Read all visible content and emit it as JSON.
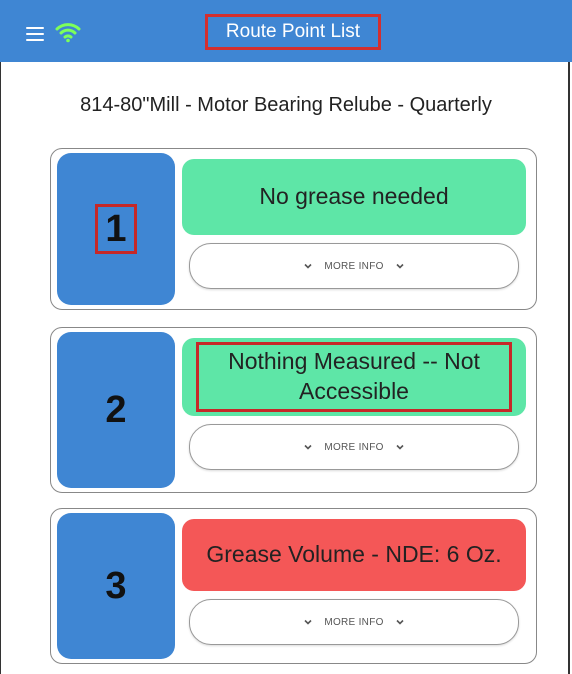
{
  "topbar": {
    "menu_icon": "hamburger-menu-icon",
    "wifi_icon": "wifi-icon",
    "title": "Route Point List"
  },
  "route": {
    "name": "814-80\"Mill - Motor Bearing Relube - Quarterly"
  },
  "points": [
    {
      "number": "1",
      "status": "No grease needed",
      "status_color": "#5ee6a7",
      "more_label": "MORE INFO"
    },
    {
      "number": "2",
      "status": "Nothing Measured -- Not Accessible",
      "status_color": "#5ee6a7",
      "more_label": "MORE INFO"
    },
    {
      "number": "3",
      "status": "Grease Volume - NDE: 6 Oz.",
      "status_color": "#f45757",
      "more_label": "MORE INFO"
    }
  ],
  "colors": {
    "header_blue": "#3f86d3",
    "highlight_red": "#c62828"
  }
}
